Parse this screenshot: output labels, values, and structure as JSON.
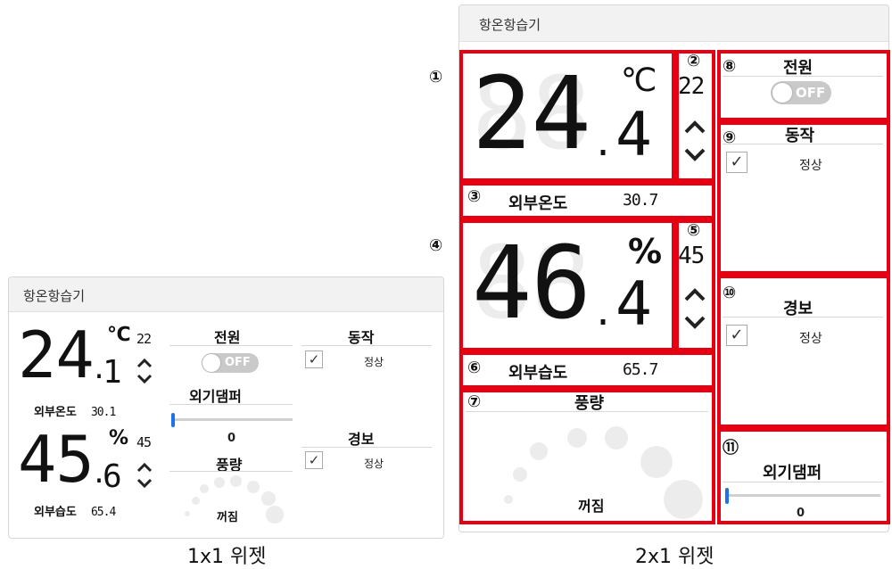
{
  "small_widget": {
    "title": "항온항습기",
    "temp": {
      "value": "24",
      "decimal": "1",
      "unit": "℃",
      "setpoint": "22",
      "outside_label": "외부온도",
      "outside_value": "30.1"
    },
    "humidity": {
      "value": "45",
      "decimal": "6",
      "unit": "%",
      "setpoint": "45",
      "outside_label": "외부습도",
      "outside_value": "65.4"
    },
    "power": {
      "label": "전원",
      "state": "OFF"
    },
    "damper": {
      "label": "외기댐퍼",
      "value": "0",
      "fraction": 0
    },
    "fan": {
      "label": "풍량",
      "state": "꺼짐"
    },
    "operation": {
      "label": "동작",
      "status": "정상",
      "checked": true
    },
    "alarm": {
      "label": "경보",
      "status": "정상",
      "checked": true
    }
  },
  "large_widget": {
    "title": "항온항습기",
    "temp": {
      "value": "24",
      "decimal": "4",
      "unit": "℃",
      "setpoint": "22",
      "outside_label": "외부온도",
      "outside_value": "30.7"
    },
    "humidity": {
      "value": "46",
      "decimal": "4",
      "unit": "%",
      "setpoint": "45",
      "outside_label": "외부습도",
      "outside_value": "65.7"
    },
    "power": {
      "label": "전원",
      "state": "OFF"
    },
    "operation": {
      "label": "동작",
      "status": "정상",
      "checked": true
    },
    "alarm": {
      "label": "경보",
      "status": "정상",
      "checked": true
    },
    "fan": {
      "label": "풍량",
      "state": "꺼짐"
    },
    "damper": {
      "label": "외기댐퍼",
      "value": "0",
      "fraction": 0
    }
  },
  "markers": [
    "①",
    "②",
    "③",
    "④",
    "⑤",
    "⑥",
    "⑦",
    "⑧",
    "⑨",
    "⑩",
    "⑪"
  ],
  "captions": {
    "small": "1x1 위젯",
    "large": "2x1 위젯"
  },
  "icons": {
    "up": "chevron-up-icon",
    "down": "chevron-down-icon",
    "check": "check-icon"
  },
  "colors": {
    "highlight": "#e60012",
    "slider": "#1a73e8",
    "toggle_off": "#c9c9c9"
  }
}
